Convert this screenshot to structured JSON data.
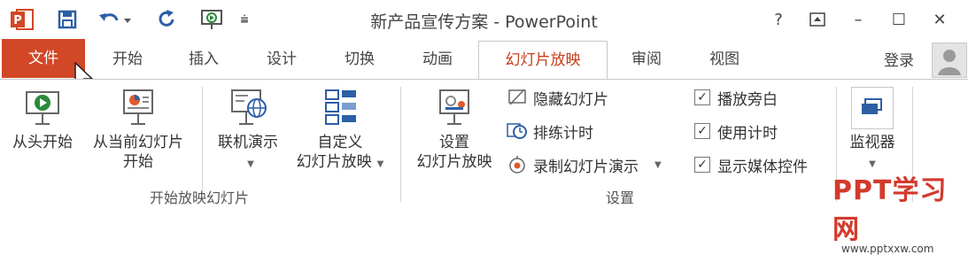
{
  "window": {
    "title": "新产品宣传方案 - PowerPoint"
  },
  "quick_access": {
    "app_icon": "P"
  },
  "window_controls": {
    "help": "?",
    "ribbon_display": "⊡",
    "minimize": "–",
    "maximize": "☐",
    "close": "✕"
  },
  "tabs": [
    {
      "label": "文件"
    },
    {
      "label": "开始"
    },
    {
      "label": "插入"
    },
    {
      "label": "设计"
    },
    {
      "label": "切换"
    },
    {
      "label": "动画"
    },
    {
      "label": "幻灯片放映"
    },
    {
      "label": "审阅"
    },
    {
      "label": "视图"
    }
  ],
  "account": {
    "login_label": "登录"
  },
  "ribbon": {
    "start_group": {
      "label": "开始放映幻灯片",
      "from_beginning": "从头开始",
      "from_current_1": "从当前幻灯片",
      "from_current_2": "开始",
      "online_present": "联机演示",
      "custom_1": "自定义",
      "custom_2": "幻灯片放映"
    },
    "setup_group": {
      "label": "设置",
      "setup_1": "设置",
      "setup_2": "幻灯片放映",
      "hide_slide": "隐藏幻灯片",
      "rehearse": "排练计时",
      "record": "录制幻灯片演示",
      "play_narration": "播放旁白",
      "use_timings": "使用计时",
      "show_media_controls": "显示媒体控件"
    },
    "monitor_group": {
      "monitor": "监视器"
    }
  },
  "watermark": {
    "title": "PPT学习网",
    "url": "www.pptxxw.com"
  },
  "colors": {
    "file_tab": "#d24726",
    "active_tab_text": "#c43e1c",
    "accent_blue": "#2b6cb0"
  }
}
